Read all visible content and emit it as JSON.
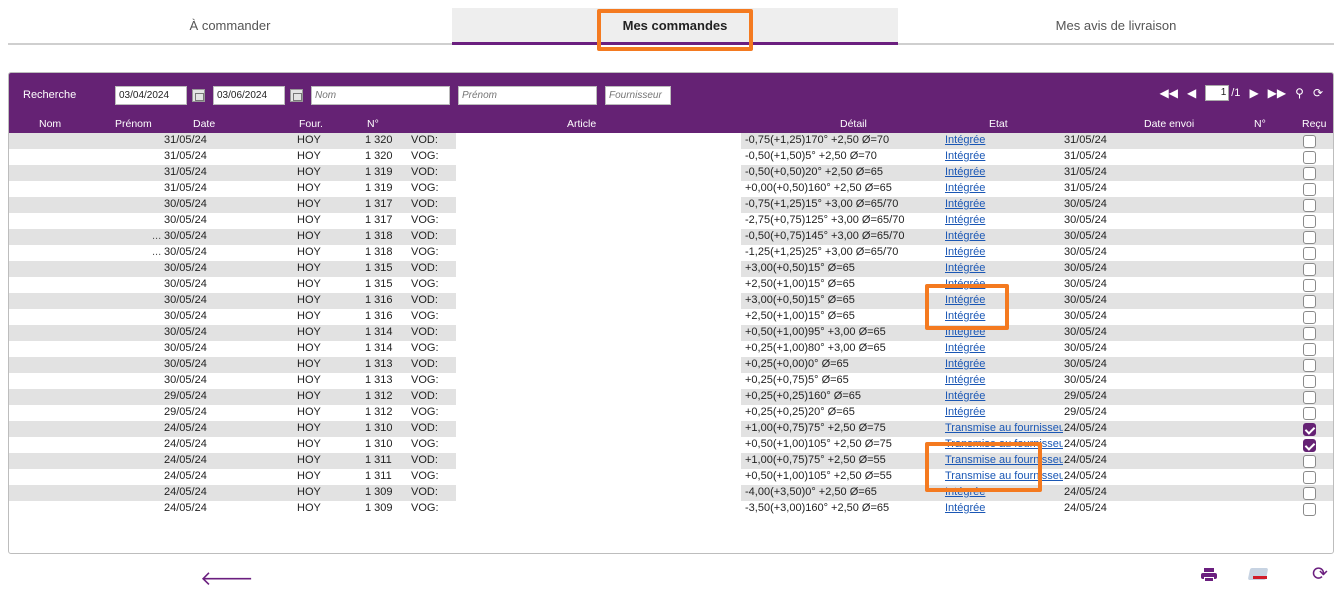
{
  "tabs": [
    {
      "label": "À commander",
      "active": false
    },
    {
      "label": "Mes commandes",
      "active": true
    },
    {
      "label": "Mes avis de livraison",
      "active": false
    }
  ],
  "search": {
    "label": "Recherche",
    "date_from": "03/04/2024",
    "date_to": "03/06/2024",
    "nom_placeholder": "Nom",
    "prenom_placeholder": "Prénom",
    "fournisseur_placeholder": "Fournisseur"
  },
  "pager": {
    "current_page": "1",
    "total_pages": "/1",
    "first_icon": "double-left-arrow",
    "prev_icon": "left-arrow",
    "next_icon": "right-arrow",
    "last_icon": "double-right-arrow",
    "search_icon": "magnifier",
    "refresh_icon": "refresh"
  },
  "columns": [
    "Nom",
    "Prénom",
    "Date",
    "Four.",
    "N°",
    "Article",
    "Détail",
    "Etat",
    "Date envoi",
    "N°",
    "Reçu"
  ],
  "rows": [
    {
      "dot": "",
      "date": "31/05/24",
      "four": "HOY",
      "no": "1 320",
      "article": "VOD:",
      "detail": "-0,75(+1,25)170° +2,50 Ø=70",
      "etat": "Intégrée",
      "envoi": "31/05/24",
      "recu": false
    },
    {
      "dot": "",
      "date": "31/05/24",
      "four": "HOY",
      "no": "1 320",
      "article": "VOG:",
      "detail": "-0,50(+1,50)5° +2,50 Ø=70",
      "etat": "Intégrée",
      "envoi": "31/05/24",
      "recu": false
    },
    {
      "dot": "",
      "date": "31/05/24",
      "four": "HOY",
      "no": "1 319",
      "article": "VOD:",
      "detail": "-0,50(+0,50)20° +2,50 Ø=65",
      "etat": "Intégrée",
      "envoi": "31/05/24",
      "recu": false
    },
    {
      "dot": "",
      "date": "31/05/24",
      "four": "HOY",
      "no": "1 319",
      "article": "VOG:",
      "detail": "+0,00(+0,50)160° +2,50 Ø=65",
      "etat": "Intégrée",
      "envoi": "31/05/24",
      "recu": false
    },
    {
      "dot": "",
      "date": "30/05/24",
      "four": "HOY",
      "no": "1 317",
      "article": "VOD:",
      "detail": "-0,75(+1,25)15° +3,00 Ø=65/70",
      "etat": "Intégrée",
      "envoi": "30/05/24",
      "recu": false
    },
    {
      "dot": "",
      "date": "30/05/24",
      "four": "HOY",
      "no": "1 317",
      "article": "VOG:",
      "detail": "-2,75(+0,75)125° +3,00 Ø=65/70",
      "etat": "Intégrée",
      "envoi": "30/05/24",
      "recu": false
    },
    {
      "dot": "...",
      "date": "30/05/24",
      "four": "HOY",
      "no": "1 318",
      "article": "VOD:",
      "detail": "-0,50(+0,75)145° +3,00 Ø=65/70",
      "etat": "Intégrée",
      "envoi": "30/05/24",
      "recu": false
    },
    {
      "dot": "...",
      "date": "30/05/24",
      "four": "HOY",
      "no": "1 318",
      "article": "VOG:",
      "detail": "-1,25(+1,25)25° +3,00 Ø=65/70",
      "etat": "Intégrée",
      "envoi": "30/05/24",
      "recu": false
    },
    {
      "dot": "",
      "date": "30/05/24",
      "four": "HOY",
      "no": "1 315",
      "article": "VOD:",
      "detail": "+3,00(+0,50)15° Ø=65",
      "etat": "Intégrée",
      "envoi": "30/05/24",
      "recu": false
    },
    {
      "dot": "",
      "date": "30/05/24",
      "four": "HOY",
      "no": "1 315",
      "article": "VOG:",
      "detail": "+2,50(+1,00)15° Ø=65",
      "etat": "Intégrée",
      "envoi": "30/05/24",
      "recu": false
    },
    {
      "dot": "",
      "date": "30/05/24",
      "four": "HOY",
      "no": "1 316",
      "article": "VOD:",
      "detail": "+3,00(+0,50)15° Ø=65",
      "etat": "Intégrée",
      "envoi": "30/05/24",
      "recu": false
    },
    {
      "dot": "",
      "date": "30/05/24",
      "four": "HOY",
      "no": "1 316",
      "article": "VOG:",
      "detail": "+2,50(+1,00)15° Ø=65",
      "etat": "Intégrée",
      "envoi": "30/05/24",
      "recu": false
    },
    {
      "dot": "",
      "date": "30/05/24",
      "four": "HOY",
      "no": "1 314",
      "article": "VOD:",
      "detail": "+0,50(+1,00)95° +3,00 Ø=65",
      "etat": "Intégrée",
      "envoi": "30/05/24",
      "recu": false
    },
    {
      "dot": "",
      "date": "30/05/24",
      "four": "HOY",
      "no": "1 314",
      "article": "VOG:",
      "detail": "+0,25(+1,00)80° +3,00 Ø=65",
      "etat": "Intégrée",
      "envoi": "30/05/24",
      "recu": false
    },
    {
      "dot": "",
      "date": "30/05/24",
      "four": "HOY",
      "no": "1 313",
      "article": "VOD:",
      "detail": "+0,25(+0,00)0° Ø=65",
      "etat": "Intégrée",
      "envoi": "30/05/24",
      "recu": false
    },
    {
      "dot": "",
      "date": "30/05/24",
      "four": "HOY",
      "no": "1 313",
      "article": "VOG:",
      "detail": "+0,25(+0,75)5° Ø=65",
      "etat": "Intégrée",
      "envoi": "30/05/24",
      "recu": false
    },
    {
      "dot": "",
      "date": "29/05/24",
      "four": "HOY",
      "no": "1 312",
      "article": "VOD:",
      "detail": "+0,25(+0,25)160° Ø=65",
      "etat": "Intégrée",
      "envoi": "29/05/24",
      "recu": false
    },
    {
      "dot": "",
      "date": "29/05/24",
      "four": "HOY",
      "no": "1 312",
      "article": "VOG:",
      "detail": "+0,25(+0,25)20° Ø=65",
      "etat": "Intégrée",
      "envoi": "29/05/24",
      "recu": false
    },
    {
      "dot": "",
      "date": "24/05/24",
      "four": "HOY",
      "no": "1 310",
      "article": "VOD:",
      "detail": "+1,00(+0,75)75° +2,50 Ø=75",
      "etat": "Transmise au fournisseur",
      "envoi": "24/05/24",
      "recu": true
    },
    {
      "dot": "",
      "date": "24/05/24",
      "four": "HOY",
      "no": "1 310",
      "article": "VOG:",
      "detail": "+0,50(+1,00)105° +2,50 Ø=75",
      "etat": "Transmise au fournisseur",
      "envoi": "24/05/24",
      "recu": true
    },
    {
      "dot": "",
      "date": "24/05/24",
      "four": "HOY",
      "no": "1 311",
      "article": "VOD:",
      "detail": "+1,00(+0,75)75° +2,50 Ø=55",
      "etat": "Transmise au fournisseur",
      "envoi": "24/05/24",
      "recu": false
    },
    {
      "dot": "",
      "date": "24/05/24",
      "four": "HOY",
      "no": "1 311",
      "article": "VOG:",
      "detail": "+0,50(+1,00)105° +2,50 Ø=55",
      "etat": "Transmise au fournisseur",
      "envoi": "24/05/24",
      "recu": false
    },
    {
      "dot": "",
      "date": "24/05/24",
      "four": "HOY",
      "no": "1 309",
      "article": "VOD:",
      "detail": "-4,00(+3,50)0° +2,50 Ø=65",
      "etat": "Intégrée",
      "envoi": "24/05/24",
      "recu": false
    },
    {
      "dot": "",
      "date": "24/05/24",
      "four": "HOY",
      "no": "1 309",
      "article": "VOG:",
      "detail": "-3,50(+3,00)160° +2,50 Ø=65",
      "etat": "Intégrée",
      "envoi": "24/05/24",
      "recu": false
    }
  ],
  "footer": {
    "back_icon": "left-arrow",
    "print_icon": "printer",
    "card_icon": "card-minus",
    "refresh_icon": "refresh"
  },
  "colors": {
    "accent": "#652274",
    "highlight": "#f47a20",
    "link": "#1a57b5",
    "row_alt": "#e2e2e2"
  }
}
